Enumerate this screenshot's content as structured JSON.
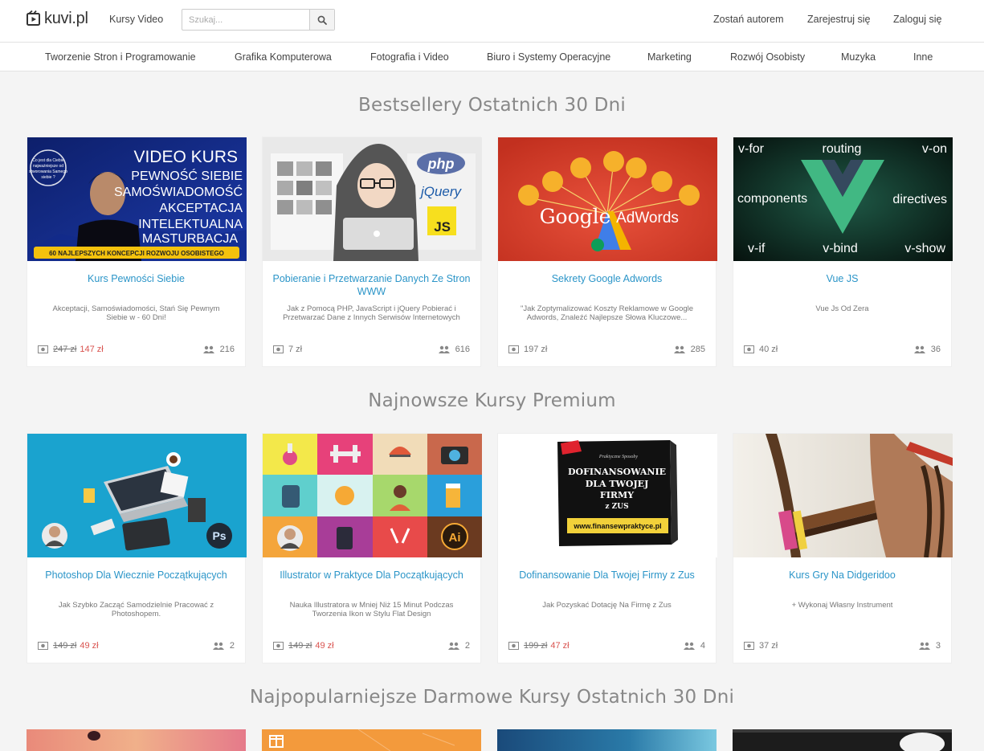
{
  "header": {
    "logo_text": "kuvi.pl",
    "nav_video": "Kursy Video",
    "search_placeholder": "Szukaj...",
    "become_author": "Zostań autorem",
    "register": "Zarejestruj się",
    "login": "Zaloguj się"
  },
  "categories": [
    "Tworzenie Stron i Programowanie",
    "Grafika Komputerowa",
    "Fotografia i Video",
    "Biuro i Systemy Operacyjne",
    "Marketing",
    "Rozwój Osobisty",
    "Muzyka",
    "Inne"
  ],
  "sections": [
    {
      "title": "Bestsellery Ostatnich 30 Dni",
      "cards": [
        {
          "title": "Kurs Pewności Siebie",
          "desc": "Akceptacji, Samoświadomości, Stań Się Pewnym Siebie w - 60 Dni!",
          "old_price": "247 zł",
          "price": "147 zł",
          "students": "216",
          "thumb": {
            "lines": [
              "VIDEO KURS",
              "PEWNOŚĆ SIEBIE",
              "SAMOŚWIADOMOŚĆ",
              "AKCEPTACJA",
              "INTELEKTUALNA",
              "MASTURBACJA"
            ],
            "bubble": [
              "Co jest dla Ciebie",
              "najważniejsze od",
              "stworowania Samego",
              "siebie ?"
            ],
            "banner": "60 NAJLEPSZYCH KONCEPCJI ROZWOJU OSOBISTEGO"
          }
        },
        {
          "title": "Pobieranie i Przetwarzanie Danych Ze Stron WWW",
          "desc": "Jak z Pomocą PHP, JavaScript i jQuery Pobierać i Przetwarzać Dane z Innych Serwisów Internetowych",
          "old_price": "",
          "price": "7 zł",
          "students": "616",
          "thumb": {
            "php": "php",
            "jquery": "jQuery",
            "js": "JS"
          }
        },
        {
          "title": "Sekrety Google Adwords",
          "desc": "\"Jak Zoptymalizować Koszty Reklamowe w Google Adwords, Znaleźć Najlepsze Słowa Kluczowe...",
          "old_price": "",
          "price": "197 zł",
          "students": "285",
          "thumb": {
            "google": "Google",
            "adwords": "AdWords"
          }
        },
        {
          "title": "Vue JS",
          "desc": "Vue Js Od Zera",
          "old_price": "",
          "price": "40 zł",
          "students": "36",
          "thumb": {
            "words": [
              "v-for",
              "routing",
              "v-on",
              "components",
              "directives",
              "v-if",
              "v-bind",
              "v-show"
            ]
          }
        }
      ]
    },
    {
      "title": "Najnowsze Kursy Premium",
      "cards": [
        {
          "title": "Photoshop Dla Wiecznie Początkujących",
          "desc": "Jak Szybko Zacząć Samodzielnie Pracować z Photoshopem.",
          "old_price": "149 zł",
          "price": "49 zł",
          "students": "2",
          "thumb": {
            "badge": "Ps"
          }
        },
        {
          "title": "Illustrator w Praktyce Dla Początkujących",
          "desc": "Nauka Illustratora w Mniej Niż 15 Minut Podczas Tworzenia Ikon w Stylu Flat Design",
          "old_price": "149 zł",
          "price": "49 zł",
          "students": "2",
          "thumb": {
            "badge": "Ai"
          }
        },
        {
          "title": "Dofinansowanie Dla Twojej Firmy z Zus",
          "desc": "Jak Pozyskać Dotację Na Firmę z Zus",
          "old_price": "199 zł",
          "price": "47 zł",
          "students": "4",
          "thumb": {
            "box_lines": [
              "DOFINANSOWANIE",
              "DLA TWOJEJ",
              "FIRMY",
              "z ZUS"
            ],
            "box_url": "www.finansewpraktyce.pl",
            "box_small": "Praktyczne Sposoby"
          }
        },
        {
          "title": "Kurs Gry Na Didgeridoo",
          "desc": "+ Wykonaj Własny Instrument",
          "old_price": "",
          "price": "37 zł",
          "students": "3",
          "thumb": {}
        }
      ]
    },
    {
      "title": "Najpopularniejsze Darmowe Kursy Ostatnich 30 Dni",
      "cards": []
    }
  ],
  "colors": {
    "link": "#2b95c8",
    "sale": "#d9534f",
    "title": "#888888"
  }
}
